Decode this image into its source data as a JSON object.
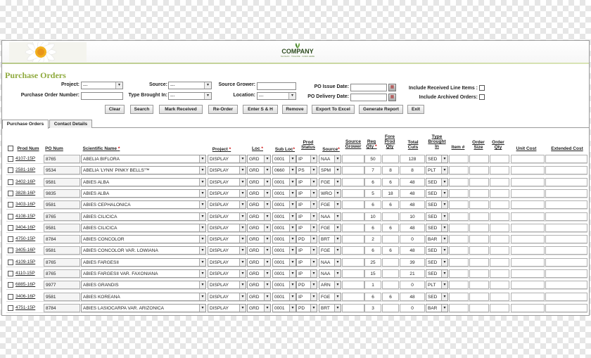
{
  "header": {
    "company": "COMPANY",
    "tagline": "SLOGAN · TAGLINE · GOES HERE"
  },
  "page_title": "Purchase Orders",
  "filters": {
    "project_label": "Project:",
    "project_value": "---",
    "po_number_label": "Purchase Order Number:",
    "source_label": "Source:",
    "source_value": "---",
    "type_brought_label": "Type Brought In:",
    "type_brought_value": "---",
    "source_grower_label": "Source Grower:",
    "location_label": "Location:",
    "location_value": "---",
    "po_issue_label": "PO Issue Date:",
    "po_delivery_label": "PO Delivery Date:",
    "include_received_label": "Include Received Line Items :",
    "include_archived_label": "Include Archived Orders:"
  },
  "buttons": [
    "Clear",
    "Search",
    "Mark Received",
    "Re-Order",
    "Enter S & H",
    "Remove",
    "Export To Excel",
    "Generate Report",
    "Exit"
  ],
  "tabs": [
    "Purchase Orders",
    "Contact Details"
  ],
  "columns": {
    "prod_num": "Prod Num",
    "po_num": "PO Num",
    "scientific_name": "Scientific Name",
    "project": "Project",
    "loc": "Loc",
    "sub_loc": "Sub Loc",
    "prod_status": "Prod Status",
    "source": "Source",
    "source_grower": "Source Grower",
    "req_qty": "Req Qty",
    "fore_prod_qty": "Fore Prod Qty",
    "total_cuts": "Total Cuts",
    "type_brought_in": "Type Brought In",
    "item_no": "Item #",
    "order_size": "Order Size",
    "order_qty": "Order Qty",
    "unit_cost": "Unit Cost",
    "extended_cost": "Extended Cost"
  },
  "rows": [
    {
      "prod": "4107-15P",
      "po": "8765",
      "name": "ABELIA BIFLORA",
      "project": "DISPLAY",
      "loc": "GRD",
      "sub": "0001",
      "status": "IP",
      "source": "NAA",
      "req": "50",
      "fore": "",
      "cuts": "128",
      "type": "SED"
    },
    {
      "prod": "2581-16P",
      "po": "9534",
      "name": "ABELIA 'LYNN' PINKY BELLS'™",
      "project": "DISPLAY",
      "loc": "GRD",
      "sub": "0660",
      "status": "PS",
      "source": "SPM",
      "req": "7",
      "fore": "8",
      "cuts": "8",
      "type": "PLT"
    },
    {
      "prod": "3402-16P",
      "po": "9581",
      "name": "ABIES ALBA",
      "project": "DISPLAY",
      "loc": "GRD",
      "sub": "0001",
      "status": "IP",
      "source": "FGE",
      "req": "6",
      "fore": "6",
      "cuts": "48",
      "type": "SED"
    },
    {
      "prod": "3828-16P",
      "po": "9835",
      "name": "ABIES ALBA",
      "project": "DISPLAY",
      "loc": "GRD",
      "sub": "0001",
      "status": "IP",
      "source": "WRO",
      "req": "5",
      "fore": "18",
      "cuts": "48",
      "type": "SED"
    },
    {
      "prod": "3403-16P",
      "po": "9581",
      "name": "ABIES CEPHALONICA",
      "project": "DISPLAY",
      "loc": "GRD",
      "sub": "0001",
      "status": "IP",
      "source": "FGE",
      "req": "6",
      "fore": "6",
      "cuts": "48",
      "type": "SED"
    },
    {
      "prod": "4108-15P",
      "po": "8765",
      "name": "ABIES CILICICA",
      "project": "DISPLAY",
      "loc": "GRD",
      "sub": "0001",
      "status": "IP",
      "source": "NAA",
      "req": "10",
      "fore": "",
      "cuts": "10",
      "type": "SED"
    },
    {
      "prod": "3404-16P",
      "po": "9581",
      "name": "ABIES CILICICA",
      "project": "DISPLAY",
      "loc": "GRD",
      "sub": "0001",
      "status": "IP",
      "source": "FGE",
      "req": "6",
      "fore": "6",
      "cuts": "48",
      "type": "SED"
    },
    {
      "prod": "4750-15P",
      "po": "8784",
      "name": "ABIES CONCOLOR",
      "project": "DISPLAY",
      "loc": "GRD",
      "sub": "0001",
      "status": "PD",
      "source": "BRT",
      "req": "2",
      "fore": "",
      "cuts": "0",
      "type": "BAR"
    },
    {
      "prod": "3405-16P",
      "po": "9581",
      "name": "ABIES CONCOLOR VAR. LOWIANA",
      "project": "DISPLAY",
      "loc": "GRD",
      "sub": "0001",
      "status": "IP",
      "source": "FGE",
      "req": "6",
      "fore": "6",
      "cuts": "48",
      "type": "SED"
    },
    {
      "prod": "4109-15P",
      "po": "8765",
      "name": "ABIES FARGESII",
      "project": "DISPLAY",
      "loc": "GRD",
      "sub": "0001",
      "status": "IP",
      "source": "NAA",
      "req": "25",
      "fore": "",
      "cuts": "39",
      "type": "SED"
    },
    {
      "prod": "4110-15P",
      "po": "8765",
      "name": "ABIES FARGESII VAR. FAXONIANA",
      "project": "DISPLAY",
      "loc": "GRD",
      "sub": "0001",
      "status": "IP",
      "source": "NAA",
      "req": "15",
      "fore": "",
      "cuts": "21",
      "type": "SED"
    },
    {
      "prod": "6885-16P",
      "po": "9977",
      "name": "ABIES GRANDIS",
      "project": "DISPLAY",
      "loc": "GRD",
      "sub": "0001",
      "status": "PD",
      "source": "ARN",
      "req": "1",
      "fore": "",
      "cuts": "0",
      "type": "PLT"
    },
    {
      "prod": "3406-16P",
      "po": "9581",
      "name": "ABIES KOREANA",
      "project": "DISPLAY",
      "loc": "GRD",
      "sub": "0001",
      "status": "IP",
      "source": "FGE",
      "req": "6",
      "fore": "6",
      "cuts": "48",
      "type": "SED"
    },
    {
      "prod": "4751-15P",
      "po": "8784",
      "name": "ABIES LASIOCARPA VAR. ARIZONICA",
      "project": "DISPLAY",
      "loc": "GRD",
      "sub": "0001",
      "status": "PD",
      "source": "BRT",
      "req": "3",
      "fore": "",
      "cuts": "0",
      "type": "BAR"
    }
  ]
}
